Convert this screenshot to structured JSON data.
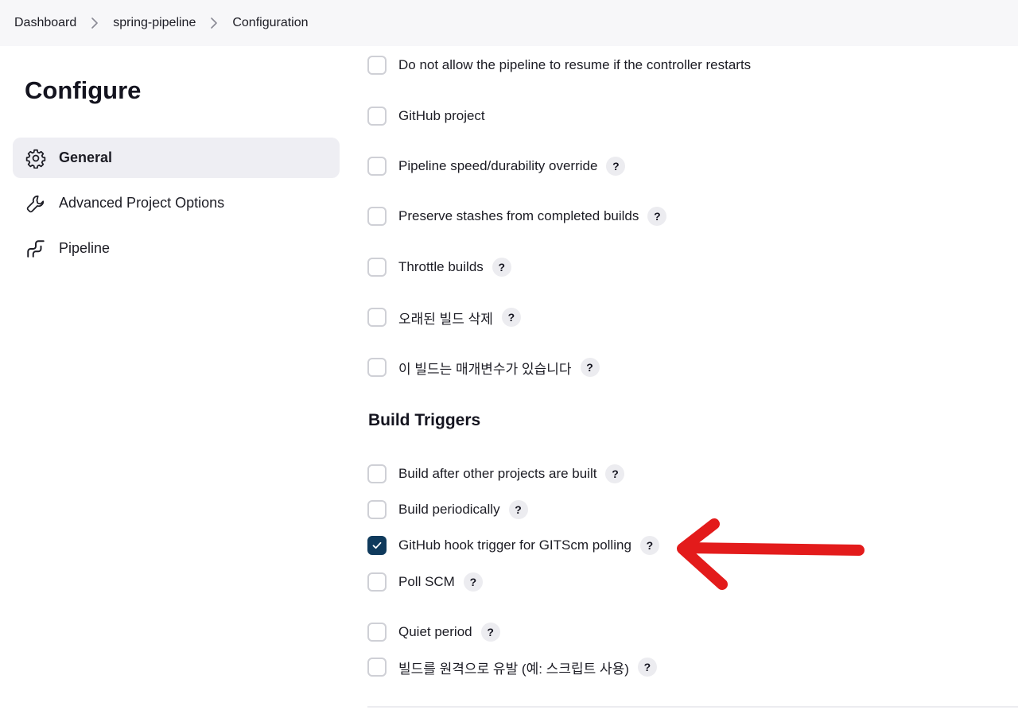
{
  "breadcrumb": {
    "items": [
      "Dashboard",
      "spring-pipeline",
      "Configuration"
    ]
  },
  "sidebar": {
    "title": "Configure",
    "items": [
      {
        "label": "General",
        "icon": "gear-icon",
        "active": true
      },
      {
        "label": "Advanced Project Options",
        "icon": "wrench-icon",
        "active": false
      },
      {
        "label": "Pipeline",
        "icon": "pipeline-icon",
        "active": false
      }
    ]
  },
  "general": {
    "options": [
      {
        "label": "Do not allow the pipeline to resume if the controller restarts",
        "checked": false,
        "help": false
      },
      {
        "label": "GitHub project",
        "checked": false,
        "help": false
      },
      {
        "label": "Pipeline speed/durability override",
        "checked": false,
        "help": true
      },
      {
        "label": "Preserve stashes from completed builds",
        "checked": false,
        "help": true
      },
      {
        "label": "Throttle builds",
        "checked": false,
        "help": true
      },
      {
        "label": "오래된 빌드 삭제",
        "checked": false,
        "help": true
      },
      {
        "label": "이 빌드는 매개변수가 있습니다",
        "checked": false,
        "help": true
      }
    ]
  },
  "build_triggers": {
    "title": "Build Triggers",
    "options": [
      {
        "label": "Build after other projects are built",
        "checked": false,
        "help": true
      },
      {
        "label": "Build periodically",
        "checked": false,
        "help": true
      },
      {
        "label": "GitHub hook trigger for GITScm polling",
        "checked": true,
        "help": true
      },
      {
        "label": "Poll SCM",
        "checked": false,
        "help": true
      },
      {
        "label": "Quiet period",
        "checked": false,
        "help": true
      },
      {
        "label": "빌드를 원격으로 유발 (예: 스크립트 사용)",
        "checked": false,
        "help": true
      }
    ]
  },
  "help_glyph": "?",
  "colors": {
    "accent": "#0f3a5c",
    "annotation_arrow": "#e31b1b",
    "sidebar_active": "#eeeef3",
    "breadcrumb_bg": "#f7f7f9"
  }
}
